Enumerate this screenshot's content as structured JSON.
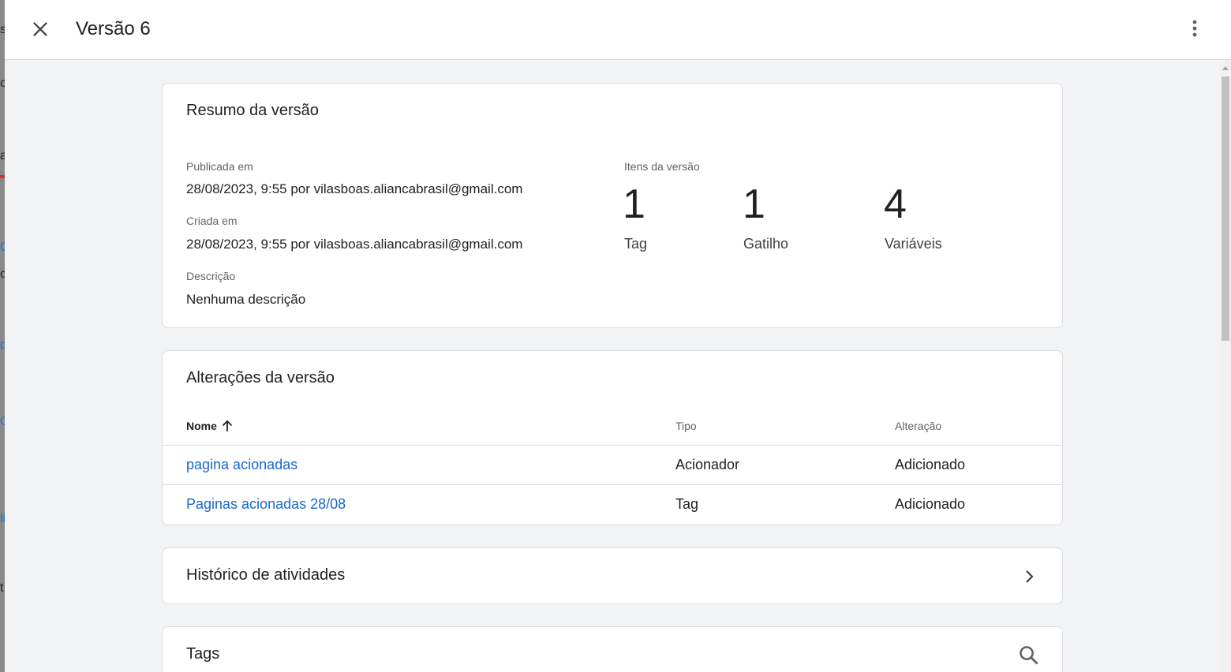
{
  "background": {
    "fragments": [
      "s",
      "c",
      "a",
      "C",
      "c",
      "d",
      "C",
      "li",
      "t"
    ]
  },
  "header": {
    "title": "Versão 6",
    "close_icon": "close-icon",
    "more_icon": "more-vert-icon"
  },
  "summary": {
    "title": "Resumo da versão",
    "published_label": "Publicada em",
    "published_value": "28/08/2023, 9:55 por vilasboas.aliancabrasil@gmail.com",
    "created_label": "Criada em",
    "created_value": "28/08/2023, 9:55 por vilasboas.aliancabrasil@gmail.com",
    "description_label": "Descrição",
    "description_value": "Nenhuma descrição",
    "items_label": "Itens da versão",
    "items": [
      {
        "count": "1",
        "label": "Tag"
      },
      {
        "count": "1",
        "label": "Gatilho"
      },
      {
        "count": "4",
        "label": "Variáveis"
      }
    ]
  },
  "changes": {
    "title": "Alterações da versão",
    "columns": [
      "Nome",
      "Tipo",
      "Alteração"
    ],
    "sort_icon": "arrow-up-icon",
    "rows": [
      {
        "name": "pagina acionadas",
        "type": "Acionador",
        "change": "Adicionado"
      },
      {
        "name": "Paginas acionadas 28/08",
        "type": "Tag",
        "change": "Adicionado"
      }
    ]
  },
  "activity": {
    "title": "Histórico de atividades",
    "icon": "chevron-right-icon"
  },
  "tags": {
    "title": "Tags",
    "icon": "search-icon"
  },
  "colors": {
    "link": "#1967d2",
    "background": "#f1f3f4",
    "card": "#ffffff",
    "border": "#dadce0"
  }
}
